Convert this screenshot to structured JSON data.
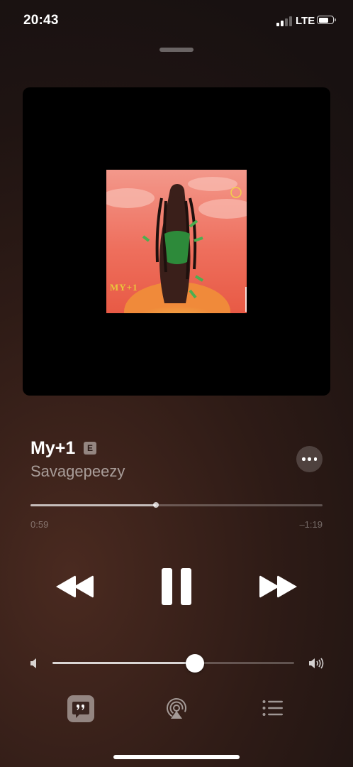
{
  "status_bar": {
    "time": "20:43",
    "network": "LTE",
    "signal_bars_active": 2,
    "signal_bars_total": 4
  },
  "artwork": {
    "title_text": "MY+1",
    "description_icon": "album-artwork"
  },
  "track": {
    "title": "My+1",
    "explicit_badge": "E",
    "artist": "Savagepeezy"
  },
  "progress": {
    "elapsed": "0:59",
    "remaining": "–1:19",
    "fraction": 0.43
  },
  "volume": {
    "level": 0.59
  },
  "controls": {
    "rewind_icon": "rewind-icon",
    "pause_icon": "pause-icon",
    "forward_icon": "fast-forward-icon",
    "lyrics_icon": "lyrics-quote-icon",
    "airplay_icon": "airplay-icon",
    "queue_icon": "queue-list-icon"
  },
  "colors": {
    "background_dark": "#1f1412",
    "background_warm": "#4a2a20",
    "foreground": "#ffffff"
  }
}
